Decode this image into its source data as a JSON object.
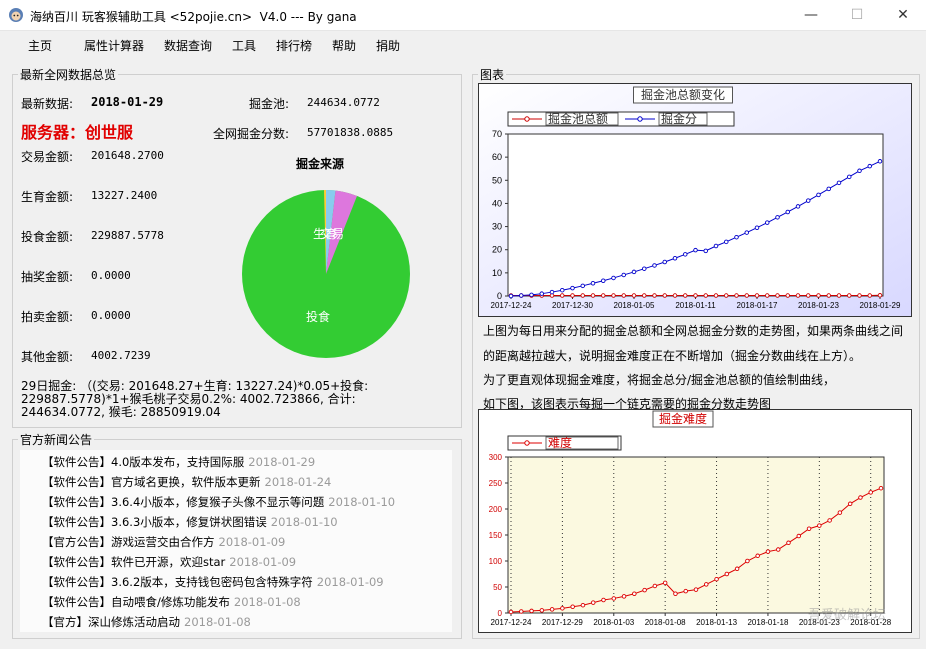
{
  "window": {
    "title": "海纳百川 玩客猴辅助工具 <52pojie.cn>  V4.0 --- By gana",
    "minimize": "—",
    "maximize": "☐",
    "close": "✕"
  },
  "menu": [
    "主页",
    "属性计算器",
    "数据查询",
    "工具",
    "排行榜",
    "帮助",
    "捐助"
  ],
  "overview": {
    "group_title": "最新全网数据总览",
    "latest_label": "最新数据:",
    "latest_date": "2018-01-29",
    "server": "服务器：创世服",
    "pool_label": "掘金池:",
    "pool_value": "244634.0772",
    "score_label": "全网掘金分数:",
    "score_value": "57701838.0885",
    "rows": [
      {
        "label": "交易金额:",
        "value": "201648.2700"
      },
      {
        "label": "生育金额:",
        "value": "13227.2400"
      },
      {
        "label": "投食金额:",
        "value": "229887.5778"
      },
      {
        "label": "抽奖金额:",
        "value": "0.0000"
      },
      {
        "label": "拍卖金额:",
        "value": "0.0000"
      },
      {
        "label": "其他金额:",
        "value": "4002.7239"
      }
    ],
    "formula": [
      "29日掘金: （(交易: 201648.27+生育: 13227.24)*0.05+投食:",
      "229887.5778)*1+猴毛桃子交易0.2%: 4002.723866, 合计:",
      "244634.0772, 猴毛: 28850919.04"
    ]
  },
  "pie": {
    "title": "掘金来源",
    "slice_labels": {
      "feed": "投食",
      "trade": "交易",
      "birth": "生育"
    },
    "colors": {
      "feed": "#33cc33",
      "trade": "#dd77dd",
      "birth": "#88ccee",
      "other": "#ffcc33"
    }
  },
  "news": {
    "group_title": "官方新闻公告",
    "items": [
      {
        "tag": "【软件公告】",
        "text": "4.0版本发布，支持国际服",
        "date": "2018-01-29"
      },
      {
        "tag": "【软件公告】",
        "text": "官方域名更换，软件版本更新",
        "date": "2018-01-24"
      },
      {
        "tag": "【软件公告】",
        "text": "3.6.4小版本，修复猴子头像不显示等问题",
        "date": "2018-01-10"
      },
      {
        "tag": "【软件公告】",
        "text": "3.6.3小版本，修复饼状图错误",
        "date": "2018-01-10"
      },
      {
        "tag": "【官方公告】",
        "text": "游戏运营交由合作方",
        "date": "2018-01-09"
      },
      {
        "tag": "【软件公告】",
        "text": "软件已开源，欢迎star",
        "date": "2018-01-09"
      },
      {
        "tag": "【软件公告】",
        "text": "3.6.2版本，支持钱包密码包含特殊字符",
        "date": "2018-01-09"
      },
      {
        "tag": "【软件公告】",
        "text": "自动喂食/修炼功能发布",
        "date": "2018-01-08"
      },
      {
        "tag": "【官方】",
        "text": "深山修炼活动启动",
        "date": "2018-01-08"
      }
    ]
  },
  "chart_section": {
    "group_title": "图表",
    "desc1": "上图为每日用来分配的掘金总额和全网总掘金分数的走势图，如果两条曲线之间",
    "desc2": "的距离越拉越大，说明掘金难度正在不断增加（掘金分数曲线在上方）。",
    "desc3": "为了更直观体现掘金难度，将掘金总分/掘金池总额的值绘制曲线，",
    "desc4": "如下图，该图表示每掘一个链克需要的掘金分数走势图",
    "watermark": "吾爱破解论坛"
  },
  "chart_data": [
    {
      "type": "line",
      "title": "掘金池总额变化",
      "legend_position": "top-left",
      "x": [
        "2017-12-24",
        "2017-12-25",
        "2017-12-26",
        "2017-12-27",
        "2017-12-28",
        "2017-12-29",
        "2017-12-30",
        "2017-12-31",
        "2018-01-01",
        "2018-01-02",
        "2018-01-03",
        "2018-01-04",
        "2018-01-05",
        "2018-01-06",
        "2018-01-07",
        "2018-01-08",
        "2018-01-09",
        "2018-01-10",
        "2018-01-11",
        "2018-01-12",
        "2018-01-13",
        "2018-01-14",
        "2018-01-15",
        "2018-01-16",
        "2018-01-17",
        "2018-01-18",
        "2018-01-19",
        "2018-01-20",
        "2018-01-21",
        "2018-01-22",
        "2018-01-23",
        "2018-01-24",
        "2018-01-25",
        "2018-01-26",
        "2018-01-27",
        "2018-01-28",
        "2018-01-29"
      ],
      "x_ticks": [
        "2017-12-24",
        "2017-12-30",
        "2018-01-05",
        "2018-01-11",
        "2018-01-17",
        "2018-01-23",
        "2018-01-29"
      ],
      "y_ticks": [
        0,
        10,
        20,
        30,
        40,
        50,
        60,
        70
      ],
      "ylim": [
        0,
        70
      ],
      "grid": false,
      "series": [
        {
          "name": "掘金池总额",
          "color": "#cc0000",
          "values": [
            0.2,
            0.2,
            0.2,
            0.2,
            0.2,
            0.2,
            0.2,
            0.2,
            0.2,
            0.2,
            0.2,
            0.2,
            0.2,
            0.2,
            0.2,
            0.2,
            0.2,
            0.2,
            0.2,
            0.2,
            0.2,
            0.2,
            0.2,
            0.2,
            0.2,
            0.2,
            0.2,
            0.2,
            0.2,
            0.2,
            0.2,
            0.2,
            0.2,
            0.2,
            0.2,
            0.2,
            0.3
          ]
        },
        {
          "name": "掘金分",
          "color": "#0000cc",
          "values": [
            0,
            0.2,
            0.5,
            1,
            1.7,
            2.5,
            3.4,
            4.4,
            5.5,
            6.6,
            7.8,
            9.1,
            10.4,
            11.8,
            13.2,
            14.7,
            16.3,
            18,
            19.8,
            19.5,
            21.6,
            23.4,
            25.4,
            27.4,
            29.5,
            31.7,
            34,
            36.3,
            38.7,
            41.2,
            43.7,
            46.3,
            48.9,
            51.5,
            54.1,
            56.1,
            58.2
          ]
        }
      ]
    },
    {
      "type": "line",
      "title": "掘金难度",
      "legend_position": "top-left",
      "x": [
        "2017-12-24",
        "2017-12-25",
        "2017-12-26",
        "2017-12-27",
        "2017-12-28",
        "2017-12-29",
        "2017-12-30",
        "2017-12-31",
        "2018-01-01",
        "2018-01-02",
        "2018-01-03",
        "2018-01-04",
        "2018-01-05",
        "2018-01-06",
        "2018-01-07",
        "2018-01-08",
        "2018-01-09",
        "2018-01-10",
        "2018-01-11",
        "2018-01-12",
        "2018-01-13",
        "2018-01-14",
        "2018-01-15",
        "2018-01-16",
        "2018-01-17",
        "2018-01-18",
        "2018-01-19",
        "2018-01-20",
        "2018-01-21",
        "2018-01-22",
        "2018-01-23",
        "2018-01-24",
        "2018-01-25",
        "2018-01-26",
        "2018-01-27",
        "2018-01-28",
        "2018-01-29"
      ],
      "x_ticks": [
        "2017-12-24",
        "2017-12-29",
        "2018-01-03",
        "2018-01-08",
        "2018-01-13",
        "2018-01-18",
        "2018-01-23",
        "2018-01-28"
      ],
      "y_ticks": [
        0,
        50,
        100,
        150,
        200,
        250,
        300
      ],
      "ylim": [
        0,
        300
      ],
      "grid": true,
      "series": [
        {
          "name": "难度",
          "color": "#dd0000",
          "values": [
            2,
            3,
            4,
            5,
            7,
            9,
            12,
            15,
            20,
            25,
            28,
            32,
            37,
            44,
            52,
            58,
            37,
            42,
            45,
            55,
            65,
            75,
            85,
            100,
            110,
            118,
            122,
            135,
            148,
            162,
            168,
            178,
            193,
            210,
            222,
            232,
            240
          ]
        }
      ]
    }
  ]
}
